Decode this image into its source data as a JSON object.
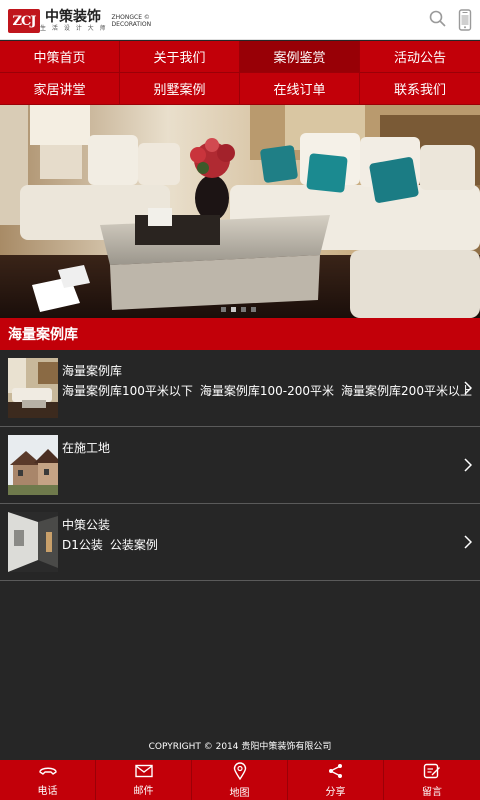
{
  "header": {
    "logo_mark": "ZCJ",
    "logo_name": "中策装饰",
    "logo_tagline": "生 活 设 计 大 师",
    "logo_en_1": "ZHONGCE ©",
    "logo_en_2": "DECORATION",
    "icons": [
      "search-icon",
      "phone-icon"
    ]
  },
  "nav": {
    "items": [
      "中策首页",
      "关于我们",
      "案例鉴赏",
      "活动公告",
      "家居讲堂",
      "别墅案例",
      "在线订单",
      "联系我们"
    ],
    "active_index": 2
  },
  "banner": {
    "slide_count": 4,
    "active_slide": 1
  },
  "section": {
    "title": "海量案例库"
  },
  "list": [
    {
      "title": "海量案例库",
      "subs": [
        "海量案例库100平米以下",
        "海量案例库100-200平米",
        "海量案例库200平米以上"
      ]
    },
    {
      "title": "在施工地",
      "subs": []
    },
    {
      "title": "中策公装",
      "subs": [
        "D1公装",
        "公装案例"
      ]
    }
  ],
  "footer": {
    "copyright": "COPYRIGHT © 2014 贵阳中策装饰有限公司"
  },
  "tabbar": {
    "items": [
      {
        "label": "电话",
        "icon": "phone-icon"
      },
      {
        "label": "邮件",
        "icon": "mail-icon"
      },
      {
        "label": "地图",
        "icon": "map-pin-icon"
      },
      {
        "label": "分享",
        "icon": "share-icon"
      },
      {
        "label": "留言",
        "icon": "message-icon"
      }
    ]
  },
  "colors": {
    "brand_red": "#c20009",
    "nav_active": "#980006",
    "list_bg": "#262626"
  }
}
